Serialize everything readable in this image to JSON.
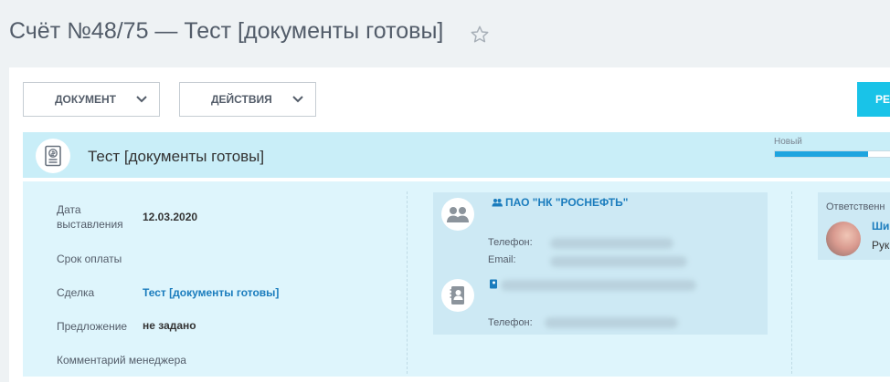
{
  "page": {
    "title": "Счёт №48/75 — Тест [документы готовы]"
  },
  "toolbar": {
    "document_label": "ДОКУМЕНТ",
    "actions_label": "ДЕЙСТВИЯ",
    "edit_label_partial": "РЕ"
  },
  "header": {
    "invoice_title": "Тест [документы готовы]",
    "status_label": "Новый",
    "status_progress": 0.8
  },
  "fields": {
    "date_label": "Дата выставления",
    "date_value": "12.03.2020",
    "due_label": "Срок оплаты",
    "deal_label": "Сделка",
    "deal_value": "Тест [документы готовы]",
    "offer_label": "Предложение",
    "offer_value": "не задано",
    "comment_label": "Комментарий менеджера"
  },
  "contacts": {
    "company_name": "ПАО \"НК \"РОСНЕФТЬ\"",
    "phone_label": "Телефон:",
    "email_label": "Email:",
    "contact_phone_label": "Телефон:"
  },
  "responsible": {
    "label_partial": "Ответственн",
    "name_partial": "Ши",
    "position_partial": "Рук"
  },
  "colors": {
    "accent": "#19c3e8",
    "header_bg": "#c9eef8",
    "panel_bg": "#def5fc",
    "link": "#1a7cbd",
    "status_fill": "#1ea4df"
  },
  "icons": {
    "favorite": "star-icon",
    "dropdown": "chevron-down-icon",
    "document": "invoice-document-icon",
    "company": "company-group-icon",
    "contact": "contact-book-icon"
  }
}
